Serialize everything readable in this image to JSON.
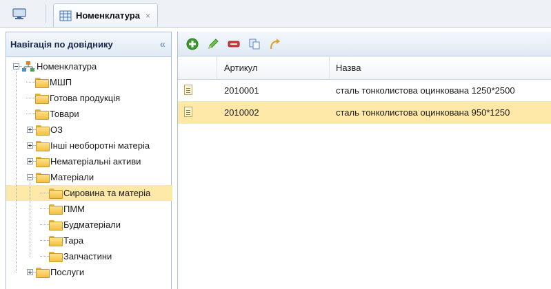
{
  "tabs": {
    "home_icon": "monitor-icon",
    "active": {
      "label": "Номенклатура",
      "icon": "catalog-grid-icon",
      "close": "×"
    }
  },
  "nav": {
    "title": "Навігація по довіднику",
    "collapse_glyph": "«",
    "tree": [
      {
        "label": "Номенклатура",
        "level": 0,
        "expander": "minus",
        "icon": "hierarchy-icon"
      },
      {
        "label": "МШП",
        "level": 1,
        "expander": "none"
      },
      {
        "label": "Готова продукція",
        "level": 1,
        "expander": "none"
      },
      {
        "label": "Товари",
        "level": 1,
        "expander": "none"
      },
      {
        "label": "ОЗ",
        "level": 1,
        "expander": "plus"
      },
      {
        "label": "Інші необоротні матеріа",
        "level": 1,
        "expander": "plus"
      },
      {
        "label": "Нематеріальні активи",
        "level": 1,
        "expander": "plus"
      },
      {
        "label": "Матеріали",
        "level": 1,
        "expander": "minus"
      },
      {
        "label": "Сировина та матеріа",
        "level": 2,
        "expander": "none",
        "selected": true
      },
      {
        "label": "ПММ",
        "level": 2,
        "expander": "none"
      },
      {
        "label": "Будматеріали",
        "level": 2,
        "expander": "none"
      },
      {
        "label": "Тара",
        "level": 2,
        "expander": "none"
      },
      {
        "label": "Запчастини",
        "level": 2,
        "expander": "none"
      },
      {
        "label": "Послуги",
        "level": 1,
        "expander": "plus"
      }
    ]
  },
  "toolbar": {
    "buttons": [
      {
        "name": "add-button",
        "icon": "plus-circle-icon",
        "color": "#3a9a2a"
      },
      {
        "name": "edit-button",
        "icon": "pencil-icon",
        "color": "#4aa82a"
      },
      {
        "name": "delete-button",
        "icon": "minus-icon",
        "color": "#d23a3a"
      },
      {
        "name": "copy-button",
        "icon": "copy-icon",
        "color": "#5a86c0"
      },
      {
        "name": "move-button",
        "icon": "curved-arrow-icon",
        "color": "#e0a030"
      }
    ]
  },
  "grid": {
    "columns": {
      "article": "Артикул",
      "name": "Назва"
    },
    "rows": [
      {
        "article": "2010001",
        "name": "сталь тонколистова оцинкована 1250*2500",
        "selected": false
      },
      {
        "article": "2010002",
        "name": "сталь тонколистова оцинкована 950*1250",
        "selected": true
      }
    ]
  },
  "colors": {
    "selection": "#fde8a8",
    "header_bg": "#dfe9f4",
    "border": "#a9bdd4"
  }
}
